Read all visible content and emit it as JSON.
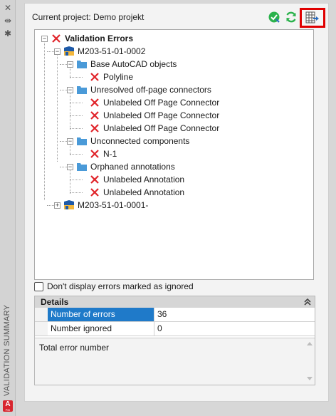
{
  "window": {
    "side_title": "VALIDATION SUMMARY",
    "close_glyph": "✕",
    "pin_glyph": "⇹",
    "settings_glyph": "✱",
    "app_logo": "A",
    "app_logo_sub": "PID"
  },
  "header": {
    "project_label": "Current project: Demo projekt",
    "tools": [
      "check-validate-icon",
      "refresh-icon",
      "export-report-icon"
    ]
  },
  "tree": {
    "root": "Validation Errors",
    "drawing_1": "M203-51-01-0002",
    "group_1": "Base AutoCAD objects",
    "item_1_1": "Polyline",
    "group_2": "Unresolved off-page connectors",
    "item_2_1": "Unlabeled Off Page Connector",
    "item_2_2": "Unlabeled Off Page Connector",
    "item_2_3": "Unlabeled Off Page Connector",
    "group_3": "Unconnected components",
    "item_3_1": "N-1",
    "group_4": "Orphaned annotations",
    "item_4_1": "Unlabeled Annotation",
    "item_4_2": "Unlabeled Annotation",
    "drawing_2": "M203-51-01-0001-"
  },
  "options": {
    "hide_ignored_label": "Don't display errors marked as ignored"
  },
  "details": {
    "title": "Details",
    "rows": [
      {
        "name": "Number of errors",
        "value": "36"
      },
      {
        "name": "Number ignored",
        "value": "0"
      }
    ],
    "description": "Total error number"
  },
  "colors": {
    "error_red": "#e0242a",
    "folder_blue": "#4a9ad8",
    "selection_blue": "#1f7ac9",
    "highlight_red": "#e00000",
    "validate_green": "#2bb24c"
  }
}
